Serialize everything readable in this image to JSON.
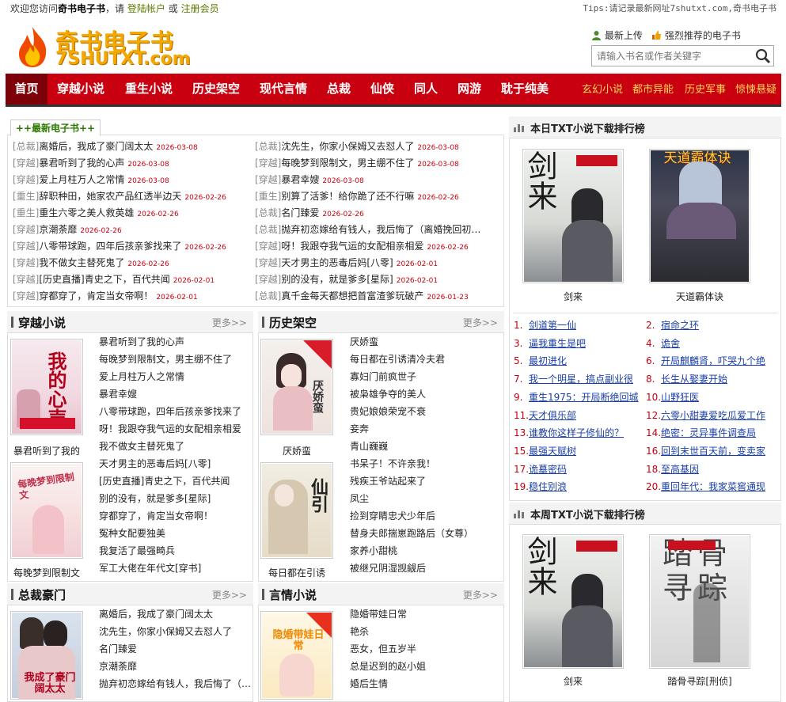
{
  "topbar": {
    "welcome": "欢迎您访问",
    "site": "奇书电子书",
    "please": "，请",
    "login": "登陆帐户",
    "or": "或",
    "register": "注册会员",
    "tips": "Tips:请记录最新网址7shutxt.com,奇书电子书"
  },
  "logo": {
    "cn": "奇书电子书",
    "en": "7SHUTXT.com"
  },
  "header": {
    "upload": "最新上传",
    "recommend": "强烈推荐的电子书",
    "search_placeholder": "请输入书名或作者关键字"
  },
  "nav": {
    "main": [
      "首页",
      "穿越小说",
      "重生小说",
      "历史架空",
      "现代言情",
      "总裁",
      "仙侠",
      "同人",
      "网游",
      "耽于纯美"
    ],
    "sub": [
      "玄幻小说",
      "都市异能",
      "历史军事",
      "惊悚悬疑"
    ]
  },
  "latest": {
    "tab": "++最新电子书++",
    "left": [
      {
        "cat": "[总裁]",
        "title": "离婚后，我成了豪门阔太太",
        "date": "2026-03-08"
      },
      {
        "cat": "[穿越]",
        "title": "暴君听到了我的心声",
        "date": "2026-03-08"
      },
      {
        "cat": "[穿越]",
        "title": "爱上月柱万人之常情",
        "date": "2026-03-08"
      },
      {
        "cat": "[重生]",
        "title": "辞职种田，她家农产品红透半边天",
        "date": "2026-02-26"
      },
      {
        "cat": "[重生]",
        "title": "重生六零之美人救英雄",
        "date": "2026-02-26"
      },
      {
        "cat": "[穿越]",
        "title": "京潮荼靡",
        "date": "2026-02-26"
      },
      {
        "cat": "[穿越]",
        "title": "八零带球跑，四年后孩亲爹找来了",
        "date": "2026-02-26"
      },
      {
        "cat": "[穿越]",
        "title": "我不做女主替死鬼了",
        "date": "2026-02-26"
      },
      {
        "cat": "[穿越]",
        "title": "[历史直播]青史之下，百代共闻",
        "date": "2026-02-01"
      },
      {
        "cat": "[穿越]",
        "title": "穿都穿了，肯定当女帝啊！",
        "date": "2026-02-01"
      }
    ],
    "right": [
      {
        "cat": "[总裁]",
        "title": "沈先生，你家小保姆又去怼人了",
        "date": "2026-03-08"
      },
      {
        "cat": "[穿越]",
        "title": "每晚梦到限制文，男主绷不住了",
        "date": "2026-03-08"
      },
      {
        "cat": "[穿越]",
        "title": "暴君幸嫂",
        "date": "2026-03-08"
      },
      {
        "cat": "[重生]",
        "title": "别算了活爹！给你跪了还不行嘛",
        "date": "2026-02-26"
      },
      {
        "cat": "[总裁]",
        "title": "名门臻爱",
        "date": "2026-02-26"
      },
      {
        "cat": "[总裁]",
        "title": "抛弃初恋嫁给有钱人，我后悔了（离婚挽回初…",
        "date": ""
      },
      {
        "cat": "[穿越]",
        "title": "呀！我跟夺我气运的女配相亲相爱",
        "date": "2026-02-26"
      },
      {
        "cat": "[穿越]",
        "title": "天才男主的恶毒后妈[八零]",
        "date": "2026-02-01"
      },
      {
        "cat": "[穿越]",
        "title": "别的没有，就是爹多[星际]",
        "date": "2026-02-01"
      },
      {
        "cat": "[总裁]",
        "title": "真千金每天都想把首富渣爹玩破产",
        "date": "2026-01-23"
      }
    ]
  },
  "sections": [
    {
      "title": "穿越小说",
      "more": "更多>>",
      "covers": [
        "暴君听到了我的",
        "每晚梦到限制文"
      ],
      "cover_text": [
        "我的心声",
        "每晚梦到限制文"
      ],
      "items": [
        "暴君听到了我的心声",
        "每晚梦到限制文，男主绷不住了",
        "爱上月柱万人之常情",
        "暴君幸嫂",
        "八零带球跑，四年后孩亲爹找来了",
        "呀！我跟夺我气运的女配相亲相爱",
        "我不做女主替死鬼了",
        "天才男主的恶毒后妈[八零]",
        "[历史直播]青史之下，百代共闻",
        "别的没有，就是爹多[星际]",
        "穿都穿了，肯定当女帝啊！",
        "冤种女配要独美",
        "我复活了最强畸兵",
        "军工大佬在年代文[穿书]"
      ]
    },
    {
      "title": "历史架空",
      "more": "更多>>",
      "covers": [
        "厌娇蛮",
        "每日都在引诱"
      ],
      "cover_text": [
        "厌娇蛮",
        "仙引"
      ],
      "items": [
        "厌娇蛮",
        "每日都在引诱清冷夫君",
        "寡妇门前疯世子",
        "被枭雄争夺的美人",
        "贵妃娘娘荣宠不衰",
        "妾奔",
        "青山巍巍",
        "书呆子！不许亲我！",
        "残疾王爷站起来了",
        "凤尘",
        "捡到穿睛忠犬少年后",
        "替身夫郎揣崽跑路后（女尊）",
        "家养小甜桃",
        "被继兄阴湿觊觎后"
      ]
    },
    {
      "title": "总裁豪门",
      "more": "更多>>",
      "covers": [],
      "cover_text": [
        "我成了豪门阔太太"
      ],
      "items": [
        "离婚后，我成了豪门阔太太",
        "沈先生，你家小保姆又去怼人了",
        "名门臻爱",
        "京潮荼靡",
        "抛弃初恋嫁给有钱人，我后悔了（…"
      ]
    },
    {
      "title": "言情小说",
      "more": "更多>>",
      "covers": [],
      "cover_text": [
        "隐婚带娃日常"
      ],
      "items": [
        "隐婚带娃日常",
        "艳杀",
        "恶女，但五岁半",
        "总是迟到的赵小姐",
        "婚后生情"
      ]
    }
  ],
  "daily": {
    "title": "本日TXT小说下载排行榜",
    "books": [
      {
        "name": "剑来",
        "cover_text": "剑来"
      },
      {
        "name": "天道霸体诀",
        "cover_text": "天道霸体诀"
      }
    ],
    "ranks": [
      {
        "n": "1.",
        "name": "剑道第一仙"
      },
      {
        "n": "2.",
        "name": "宿命之环"
      },
      {
        "n": "3.",
        "name": "逼我重生是吧"
      },
      {
        "n": "4.",
        "name": "诡舍"
      },
      {
        "n": "5.",
        "name": "最初进化"
      },
      {
        "n": "6.",
        "name": "开局麒麟肾，吓哭九个绝"
      },
      {
        "n": "7.",
        "name": "我一个明星，搞点副业很"
      },
      {
        "n": "8.",
        "name": "长生从娶妻开始"
      },
      {
        "n": "9.",
        "name": "重生1975：开局断绝回城"
      },
      {
        "n": "10.",
        "name": "山野狂医"
      },
      {
        "n": "11.",
        "name": "天才俱乐部"
      },
      {
        "n": "12.",
        "name": "六零小甜妻爱吃瓜爱工作"
      },
      {
        "n": "13.",
        "name": "谁教你这样子修仙的？"
      },
      {
        "n": "14.",
        "name": "绝密：灵异事件调查局"
      },
      {
        "n": "15.",
        "name": "最强天赋树"
      },
      {
        "n": "16.",
        "name": "回到末世百天前，变卖家"
      },
      {
        "n": "17.",
        "name": "诡墓密码"
      },
      {
        "n": "18.",
        "name": "至高基因"
      },
      {
        "n": "19.",
        "name": "稳住别浪"
      },
      {
        "n": "20.",
        "name": "重回年代：我家菜窖通现"
      }
    ]
  },
  "weekly": {
    "title": "本周TXT小说下载排行榜",
    "books": [
      {
        "name": "剑来",
        "cover_text": "剑来"
      },
      {
        "name": "踏骨寻踪[刑侦]",
        "cover_text": "踏骨寻踪"
      }
    ]
  },
  "colors": {
    "nav_red": "#c8000f",
    "date_red": "#c8000f",
    "rank_blue": "#1a3ea8",
    "logo_gold": "#f5a800"
  }
}
